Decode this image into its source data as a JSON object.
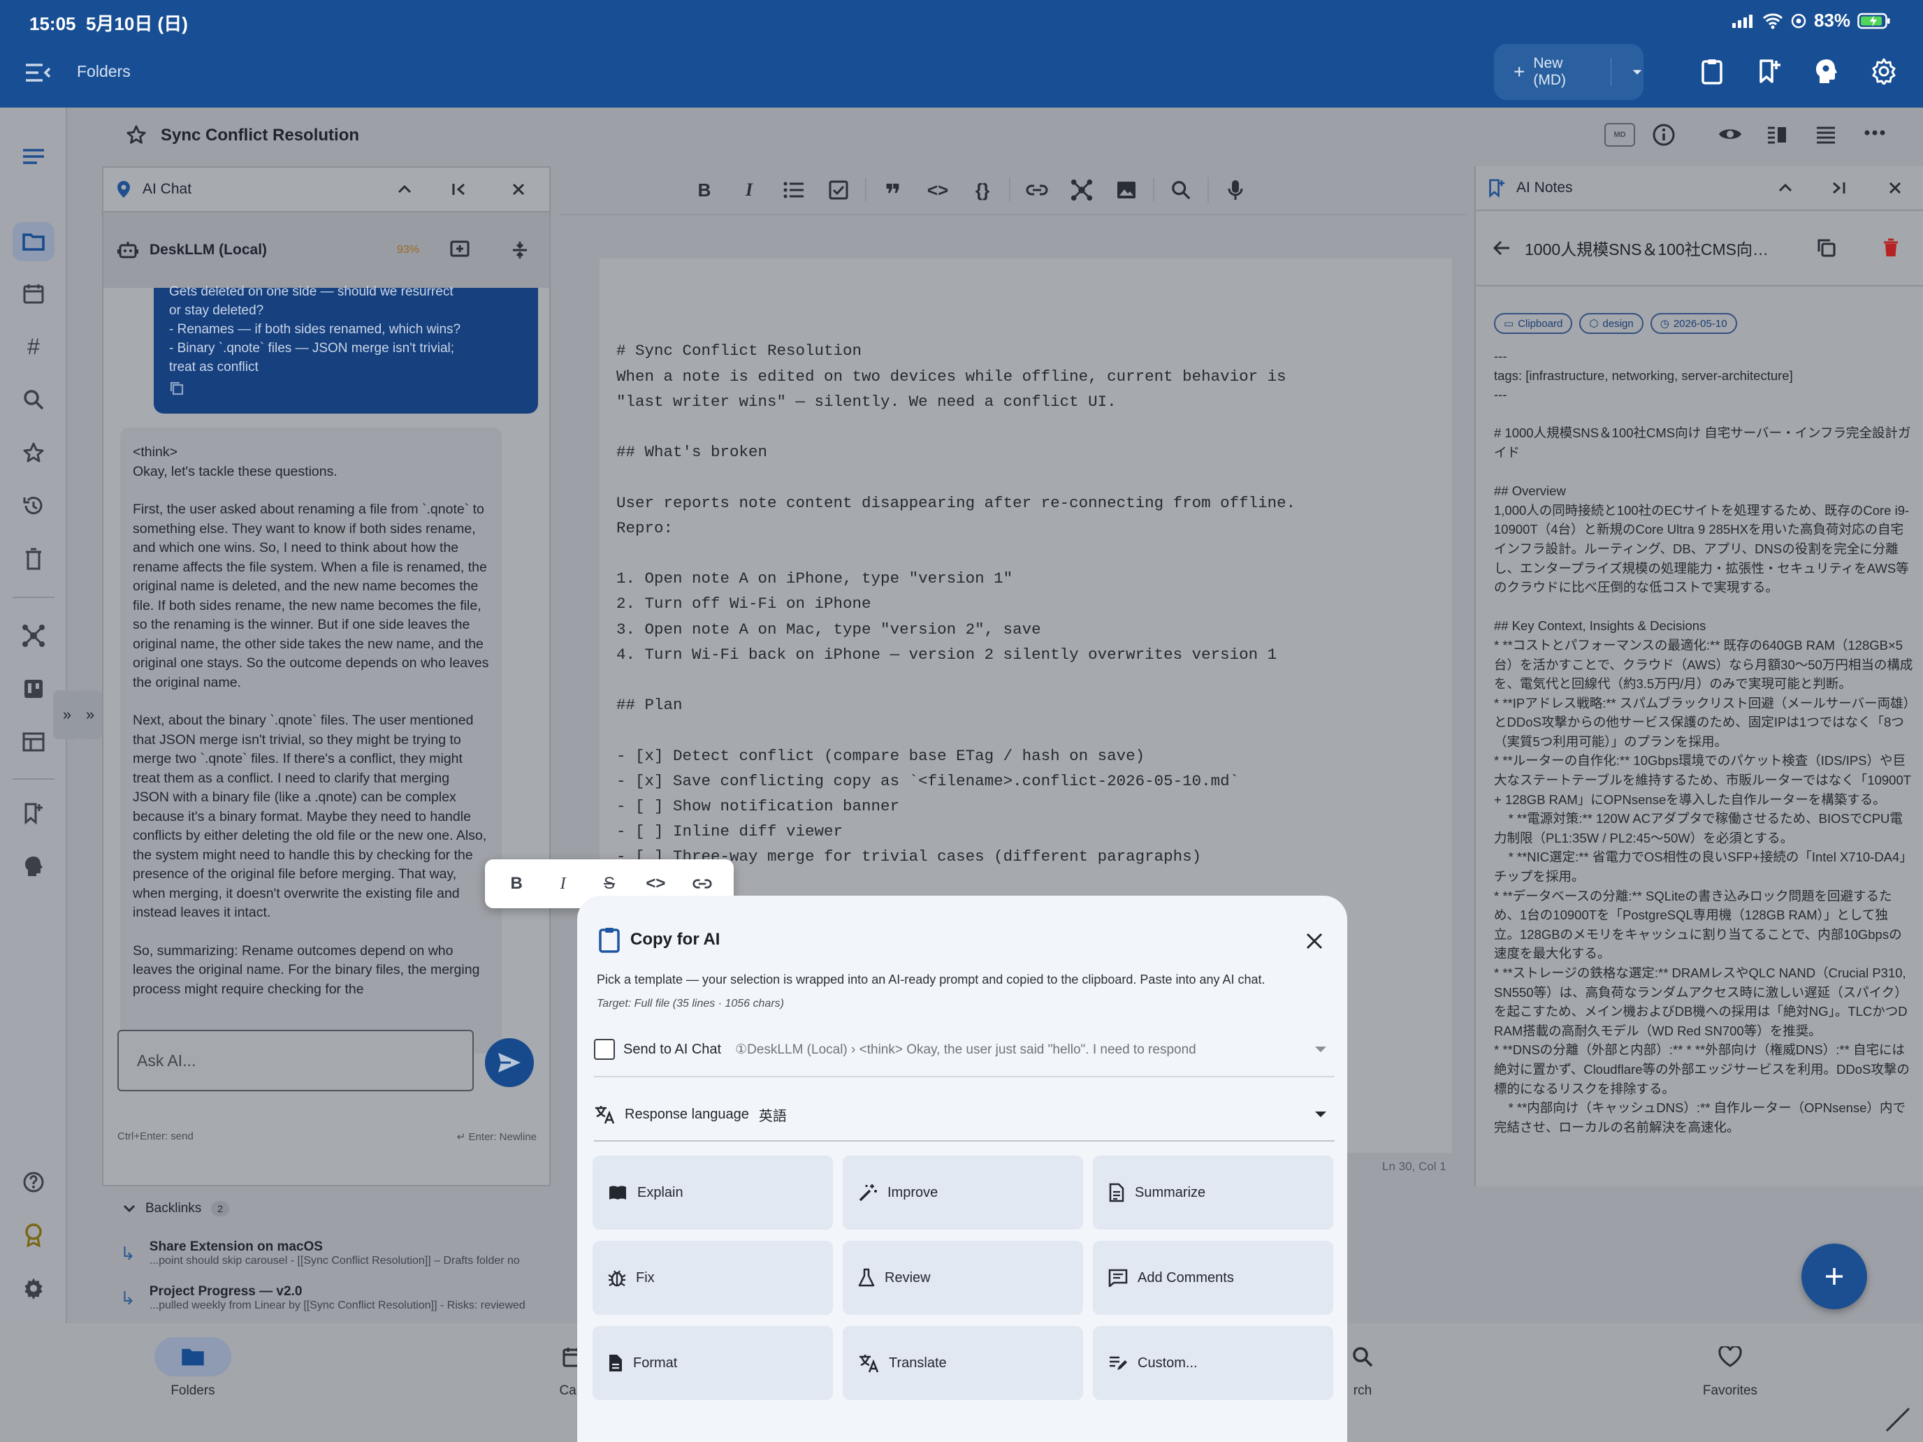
{
  "status": {
    "time": "15:05",
    "date": "5月10日 (日)",
    "battery": "83%"
  },
  "appbar": {
    "title": "Folders",
    "new_label": "New (MD)"
  },
  "document": {
    "title": "Sync Conflict Resolution",
    "md_badge": "MD",
    "cursor_pos": "Ln 30, Col 1"
  },
  "chat": {
    "title": "AI Chat",
    "model": "DeskLLM (Local)",
    "percent": "93%",
    "user_lines": [
      "Gets deleted on one side — should we resurrect",
      "or stay deleted?",
      "- Renames — if both sides renamed, which wins?",
      "- Binary `.qnote` files — JSON merge isn't trivial;",
      "treat as conflict"
    ],
    "ai_think": "<think>",
    "ai_paragraphs": [
      "Okay, let's tackle these questions.",
      "First, the user asked about renaming a file from `.qnote` to something else. They want to know if both sides rename, and which one wins. So, I need to think about how the rename affects the file system. When a file is renamed, the original name is deleted, and the new name becomes the file. If both sides rename, the new name becomes the file, so the renaming is the winner. But if one side leaves the original name, the other side takes the new name, and the original one stays. So the outcome depends on who leaves the original name.",
      "Next, about the binary `.qnote` files. The user mentioned that JSON merge isn't trivial, so they might be trying to merge two `.qnote` files. If there's a conflict, they might treat them as a conflict. I need to clarify that merging JSON with a binary file (like a .qnote) can be complex because it's a binary format. Maybe they need to handle conflicts by either deleting the old file or the new one. Also, the system might need to handle this by checking for the presence of the original file before merging. That way, when merging, it doesn't overwrite the existing file and instead leaves it intact.",
      "So, summarizing: Rename outcomes depend on who leaves the original name. For the binary files, the merging process might require checking for the"
    ],
    "input_placeholder": "Ask AI...",
    "hint_send": "Ctrl+Enter: send",
    "hint_newline": "Enter: Newline"
  },
  "editor": {
    "lines": [
      "# Sync Conflict Resolution",
      "",
      "When a note is edited on two devices while offline, current behavior is",
      "\"last writer wins\" — silently. We need a conflict UI.",
      "",
      "## What's broken",
      "",
      "User reports note content disappearing after re-connecting from offline.",
      "Repro:",
      "",
      "1. Open note A on iPhone, type \"version 1\"",
      "2. Turn off Wi-Fi on iPhone",
      "3. Open note A on Mac, type \"version 2\", save",
      "4. Turn Wi-Fi back on iPhone — version 2 silently overwrites version 1",
      "",
      "## Plan",
      "",
      "- [x] Detect conflict (compare base ETag / hash on save)",
      "- [x] Save conflicting copy as `<filename>.conflict-2026-05-10.md`",
      "- [ ] Show notification banner",
      "- [ ] Inline diff viewer",
      "- [ ] Three-way merge for trivial cases (different paragraphs)"
    ]
  },
  "notes": {
    "title": "AI Notes",
    "note_title": "1000人規模SNS＆100社CMS向…",
    "chips": [
      "Clipboard",
      "design",
      "2026-05-10"
    ],
    "body": "---\ntags: [infrastructure, networking, server-architecture]\n---\n\n# 1000人規模SNS＆100社CMS向け 自宅サーバー・インフラ完全設計ガイド\n\n## Overview\n1,000人の同時接続と100社のECサイトを処理するため、既存のCore i9-10900T（4台）と新規のCore Ultra 9 285HXを用いた高負荷対応の自宅インフラ設計。ルーティング、DB、アプリ、DNSの役割を完全に分離し、エンタープライズ規模の処理能力・拡張性・セキュリティをAWS等のクラウドに比べ圧倒的な低コストで実現する。\n\n## Key Context, Insights & Decisions\n* **コストとパフォーマンスの最適化:** 既存の640GB RAM（128GB×5台）を活かすことで、クラウド（AWS）なら月額30〜50万円相当の構成を、電気代と回線代（約3.5万円/月）のみで実現可能と判断。\n* **IPアドレス戦略:** スパムブラックリスト回避（メールサーバー両雄）とDDoS攻撃からの他サービス保護のため、固定IPは1つではなく「8つ（実質5つ利用可能）」のプランを採用。\n* **ルーターの自作化:** 10Gbps環境でのパケット検査（IDS/IPS）や巨大なステートテーブルを維持するため、市販ルーターではなく「10900T + 128GB RAM」にOPNsenseを導入した自作ルーターを構築する。\n    * **電源対策:** 120W ACアダプタで稼働させるため、BIOSでCPU電力制限（PL1:35W / PL2:45〜50W）を必須とする。\n    * **NIC選定:** 省電力でOS相性の良いSFP+接続の「Intel X710-DA4」チップを採用。\n* **データベースの分離:** SQLiteの書き込みロック問題を回避するため、1台の10900Tを「PostgreSQL専用機（128GB RAM）」として独立。128GBのメモリをキャッシュに割り当てることで、内部10Gbpsの速度を最大化する。\n* **ストレージの鉄格な選定:** DRAMレスやQLC NAND（Crucial P310, SN550等）は、高負荷なランダムアクセス時に激しい遅延（スパイク）を起こすため、メイン機およびDB機への採用は「絶対NG」。TLCかつDRAM搭載の高耐久モデル（WD Red SN700等）を推奨。\n* **DNSの分離（外部と内部）:** * **外部向け（権威DNS）:** 自宅には絶対に置かず、Cloudflare等の外部エッジサービスを利用。DDoS攻撃の標的になるリスクを排除する。\n    * **内部向け（キャッシュDNS）:** 自作ルーター（OPNsense）内で完結させ、ローカルの名前解決を高速化。"
  },
  "backlinks": {
    "label": "Backlinks",
    "count": "2",
    "items": [
      {
        "title": "Share Extension on macOS",
        "snippet": "...point should skip carousel - [[Sync Conflict Resolution]] – Drafts folder no"
      },
      {
        "title": "Project Progress — v2.0",
        "snippet": "...pulled weekly from Linear by [[Sync Conflict Resolution]] - Risks: reviewed"
      }
    ]
  },
  "bottomnav": {
    "folders": "Folders",
    "calendar": "Cale",
    "search": "rch",
    "favorites": "Favorites"
  },
  "sheet": {
    "title": "Copy for AI",
    "description": "Pick a template — your selection is wrapped into an AI-ready prompt and copied to the clipboard. Paste into any AI chat.",
    "target": "Target: Full file (35 lines · 1056 chars)",
    "send_to_chat": "Send to AI Chat",
    "chat_preview": "①DeskLLM (Local) › <think> Okay, the user just said \"hello\". I need to respond",
    "response_language_label": "Response language",
    "response_language_value": "英語",
    "actions": [
      "Explain",
      "Improve",
      "Summarize",
      "Fix",
      "Review",
      "Add Comments",
      "Format",
      "Translate",
      "Custom..."
    ]
  },
  "colors": {
    "app_blue": "#184f94",
    "accent_red": "#c62828",
    "sheet_bg": "#f2f5fa",
    "action_bg": "#e2e8f1"
  }
}
